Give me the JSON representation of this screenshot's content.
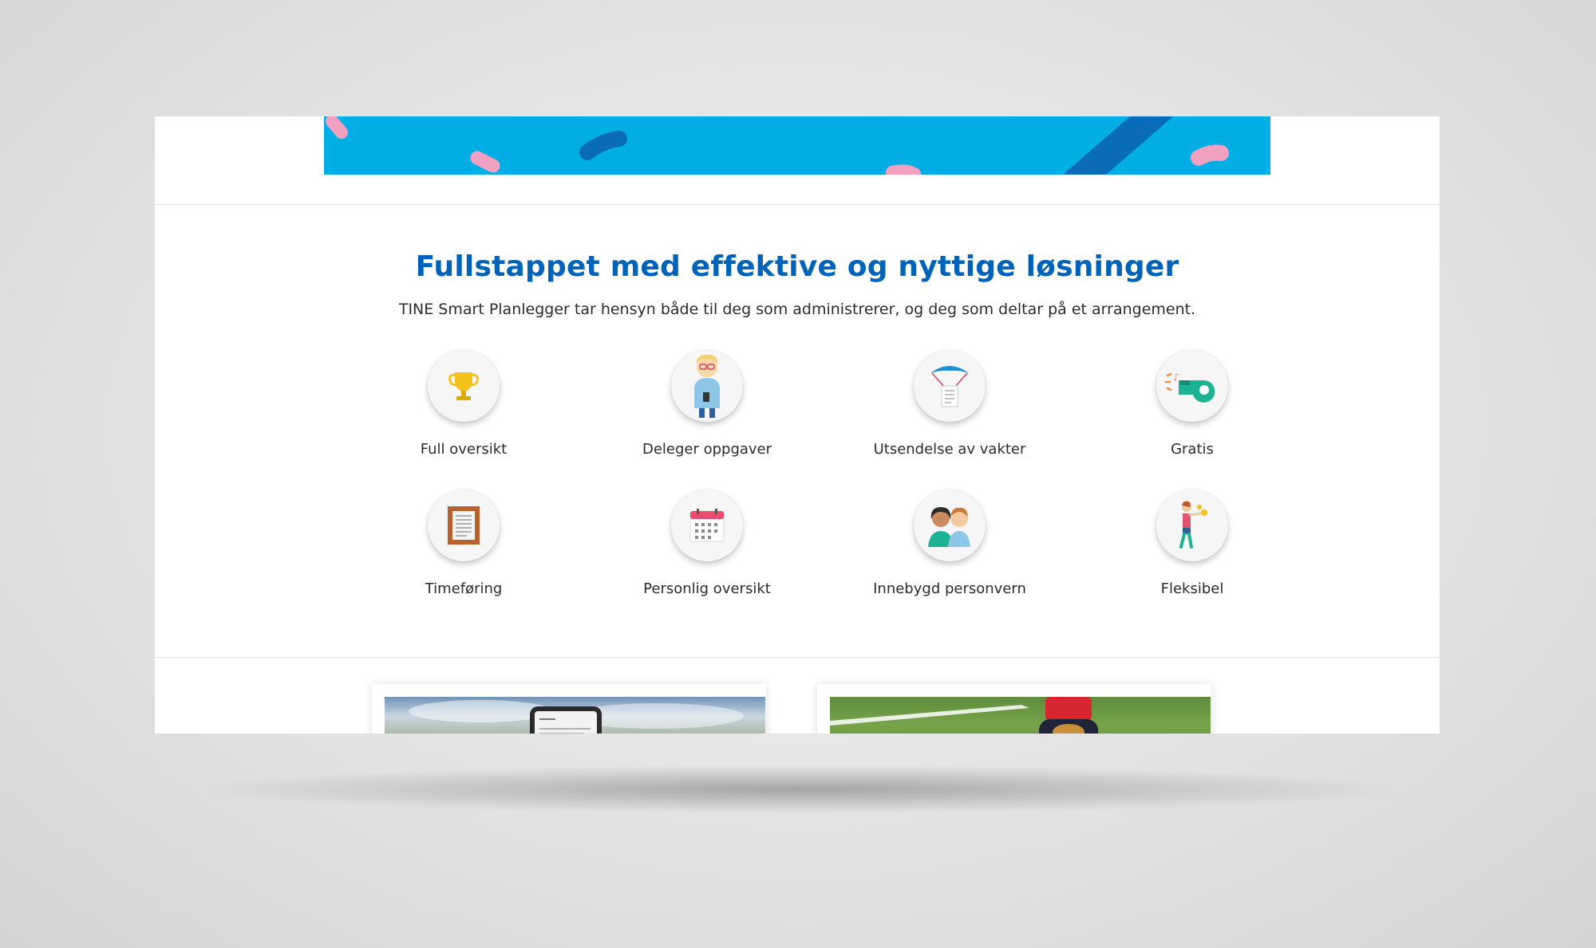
{
  "features": {
    "title": "Fullstappet med effektive og nyttige løsninger",
    "subtitle": "TINE Smart Planlegger tar hensyn både til deg som administrerer, og deg som deltar på et arrangement.",
    "items": [
      {
        "label": "Full oversikt",
        "icon": "trophy-icon"
      },
      {
        "label": "Deleger oppgaver",
        "icon": "person-with-badge-icon"
      },
      {
        "label": "Utsendelse av vakter",
        "icon": "parachute-document-icon"
      },
      {
        "label": "Gratis",
        "icon": "whistle-icon"
      },
      {
        "label": "Timeføring",
        "icon": "framed-timesheet-icon"
      },
      {
        "label": "Personlig oversikt",
        "icon": "calendar-icon"
      },
      {
        "label": "Innebygd personvern",
        "icon": "two-people-icon"
      },
      {
        "label": "Fleksibel",
        "icon": "juggling-person-icon"
      }
    ]
  },
  "colors": {
    "banner": "#00aee6",
    "accent_dark_blue": "#0a6bb8",
    "pink": "#f3a1c0",
    "headline": "#0062b8"
  }
}
